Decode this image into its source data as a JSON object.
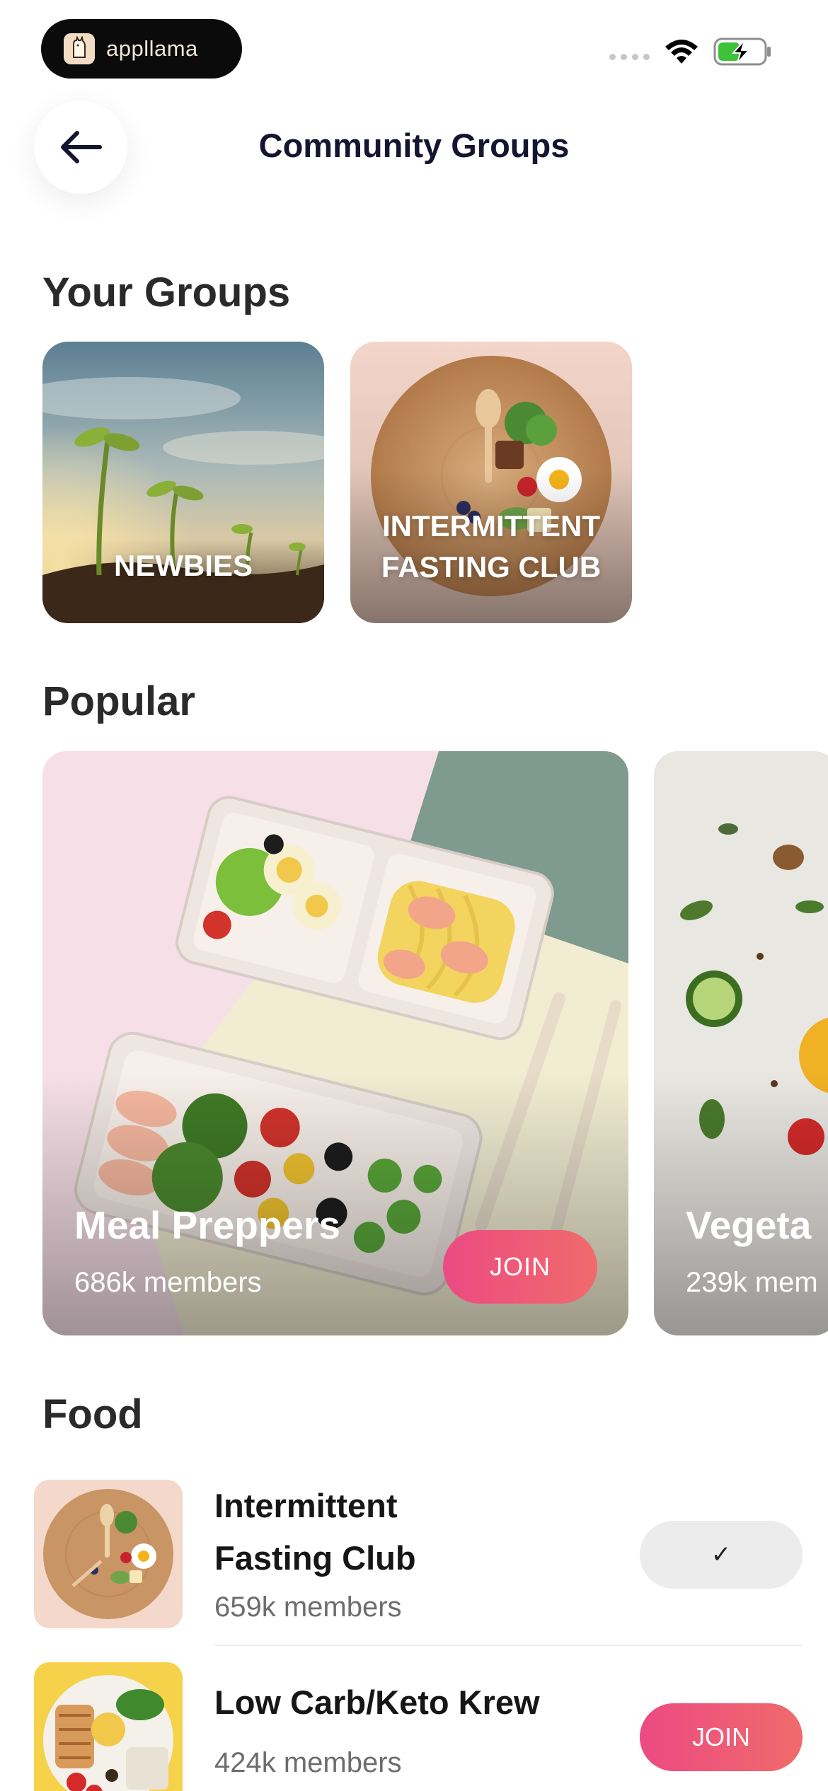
{
  "status_bar": {
    "brand_name": "appllama",
    "icons": [
      "signal-dots-icon",
      "wifi-icon",
      "battery-charging-icon"
    ],
    "battery_color": "#3ec23a"
  },
  "header": {
    "title": "Community Groups",
    "back_icon": "arrow-left-icon"
  },
  "your_groups": {
    "title": "Your Groups",
    "items": [
      {
        "label": "NEWBIES"
      },
      {
        "label": "INTERMITTENT FASTING CLUB"
      }
    ]
  },
  "popular": {
    "title": "Popular",
    "cards": [
      {
        "name": "Meal Preppers",
        "members": "686k members",
        "button": "JOIN"
      },
      {
        "name": "Vegeta",
        "members": "239k mem"
      }
    ]
  },
  "food": {
    "title": "Food",
    "items": [
      {
        "name": "Intermittent Fasting Club",
        "name_line1": "Intermittent",
        "name_line2": "Fasting Club",
        "members": "659k members",
        "button": "✓",
        "joined": true
      },
      {
        "name": "Low Carb/Keto Krew",
        "members": "424k members",
        "button": "JOIN",
        "joined": false
      }
    ]
  },
  "colors": {
    "accent_gradient_start": "#ec4a82",
    "accent_gradient_end": "#f06b6b",
    "title_color": "#141631"
  }
}
